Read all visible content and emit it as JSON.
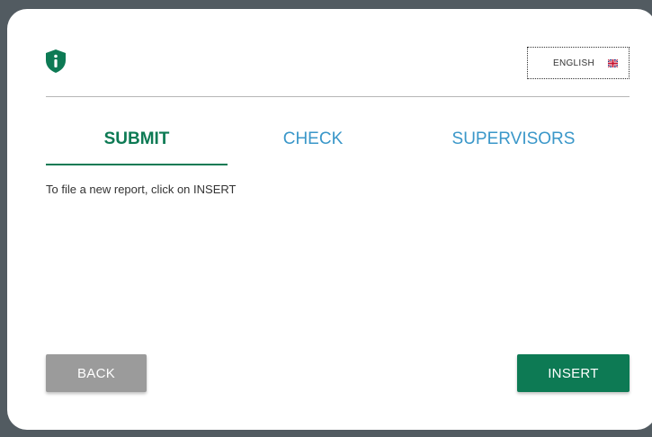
{
  "header": {
    "logo_icon": "shield-info-icon",
    "language_label": "ENGLISH",
    "language_flag_icon": "uk-flag-icon"
  },
  "tabs": [
    {
      "label": "SUBMIT",
      "active": true
    },
    {
      "label": "CHECK",
      "active": false
    },
    {
      "label": "SUPERVISORS",
      "active": false
    }
  ],
  "content": {
    "instruction": "To file a new report, click on INSERT"
  },
  "buttons": {
    "back_label": "BACK",
    "insert_label": "INSERT"
  },
  "colors": {
    "accent_green": "#0d7a54",
    "tab_blue": "#3a97c9",
    "back_gray": "#9b9b9b",
    "backdrop": "#525b61"
  }
}
